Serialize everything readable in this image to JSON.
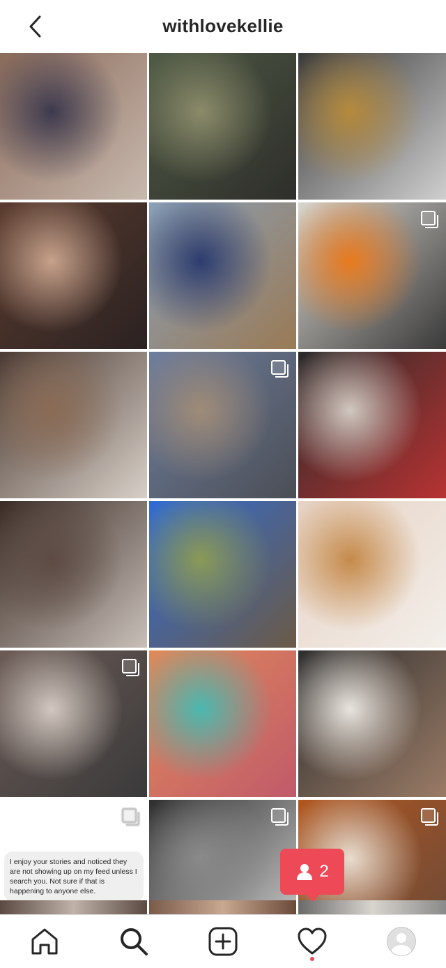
{
  "header": {
    "title": "withlovekellie",
    "back_icon": "chevron-left-icon"
  },
  "grid": {
    "tiles": [
      {
        "name": "family-selfie-post",
        "colors": [
          "#8b6b5a",
          "#3d3a4e",
          "#c8b9ae"
        ],
        "multi": false
      },
      {
        "name": "green-shirt-post",
        "colors": [
          "#4e5a45",
          "#8b8b6a",
          "#2e2e2a"
        ],
        "multi": false
      },
      {
        "name": "couple-kitchen-post",
        "colors": [
          "#3a3a3a",
          "#b58a3c",
          "#cfcfcf"
        ],
        "multi": false
      },
      {
        "name": "mom-daughter-selfie-post",
        "colors": [
          "#5a3b2e",
          "#c7a28c",
          "#2b2222"
        ],
        "multi": false
      },
      {
        "name": "grandma-kids-outdoor-post",
        "colors": [
          "#8aa0b8",
          "#2c3c6e",
          "#9a7a55"
        ],
        "multi": false
      },
      {
        "name": "kids-orange-box-post",
        "colors": [
          "#d9d6cf",
          "#e87a1e",
          "#3a3a3a"
        ],
        "multi": true
      },
      {
        "name": "boy-kitchen-counter-post",
        "colors": [
          "#4a3a33",
          "#8a6b55",
          "#d8d0c8"
        ],
        "multi": false
      },
      {
        "name": "lake-walk-post",
        "colors": [
          "#6e7e9e",
          "#a08c78",
          "#4b4e55"
        ],
        "multi": true
      },
      {
        "name": "mom-peace-sign-post",
        "colors": [
          "#2a2a2a",
          "#d0c8c0",
          "#b83232"
        ],
        "multi": false
      },
      {
        "name": "couch-family-post",
        "colors": [
          "#3a2b25",
          "#5d4b44",
          "#c8c0b8"
        ],
        "multi": false
      },
      {
        "name": "backyard-trees-post",
        "colors": [
          "#2f6bd6",
          "#8b9a55",
          "#6b5a45"
        ],
        "multi": false
      },
      {
        "name": "diffuser-hello-post",
        "colors": [
          "#e6d2c4",
          "#c58a4a",
          "#f3efea"
        ],
        "multi": false
      },
      {
        "name": "kitchen-baking-post",
        "colors": [
          "#6b5a55",
          "#d2c8c0",
          "#3a3a3a"
        ],
        "multi": true
      },
      {
        "name": "crochet-blanket-post",
        "colors": [
          "#e08a5a",
          "#4ab8b0",
          "#c05a6a"
        ],
        "multi": false
      },
      {
        "name": "kids-homework-post",
        "colors": [
          "#2e2e2e",
          "#e8e4de",
          "#9a7b66"
        ],
        "multi": false
      },
      {
        "name": "story-message-post",
        "text": true,
        "multi": true
      },
      {
        "name": "bw-window-boy-post",
        "colors": [
          "#2e2e2e",
          "#8a8a8a",
          "#d0d0d0"
        ],
        "multi": true
      },
      {
        "name": "girl-sissy-sweater-post",
        "colors": [
          "#b0561e",
          "#e8ddd0",
          "#6b4a3a"
        ],
        "multi": true
      }
    ],
    "message_text": "I enjoy your stories and noticed they are not showing up on my feed unless I search you. Not sure if that is happening to anyone else."
  },
  "notification": {
    "icon": "person-icon",
    "count": "2"
  },
  "nav": {
    "items": [
      "home-icon",
      "search-icon",
      "add-post-icon",
      "heart-icon",
      "profile-avatar"
    ]
  }
}
